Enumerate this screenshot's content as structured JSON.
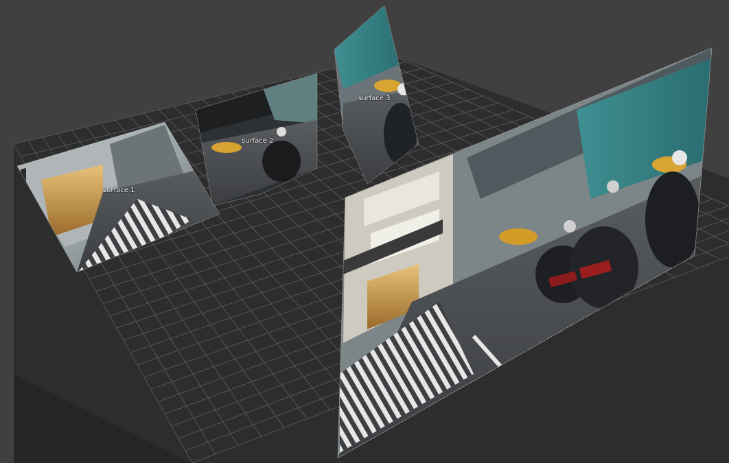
{
  "viewer": {
    "background_color": "#404040",
    "floor_color": "#2c2c2c",
    "grid_line_color": "#555555"
  },
  "surfaces": [
    {
      "id": "surface-1",
      "label": "surface 1"
    },
    {
      "id": "surface-2",
      "label": "surface 2"
    },
    {
      "id": "surface-3",
      "label": "surface 3"
    },
    {
      "id": "surface-4",
      "label": ""
    }
  ]
}
